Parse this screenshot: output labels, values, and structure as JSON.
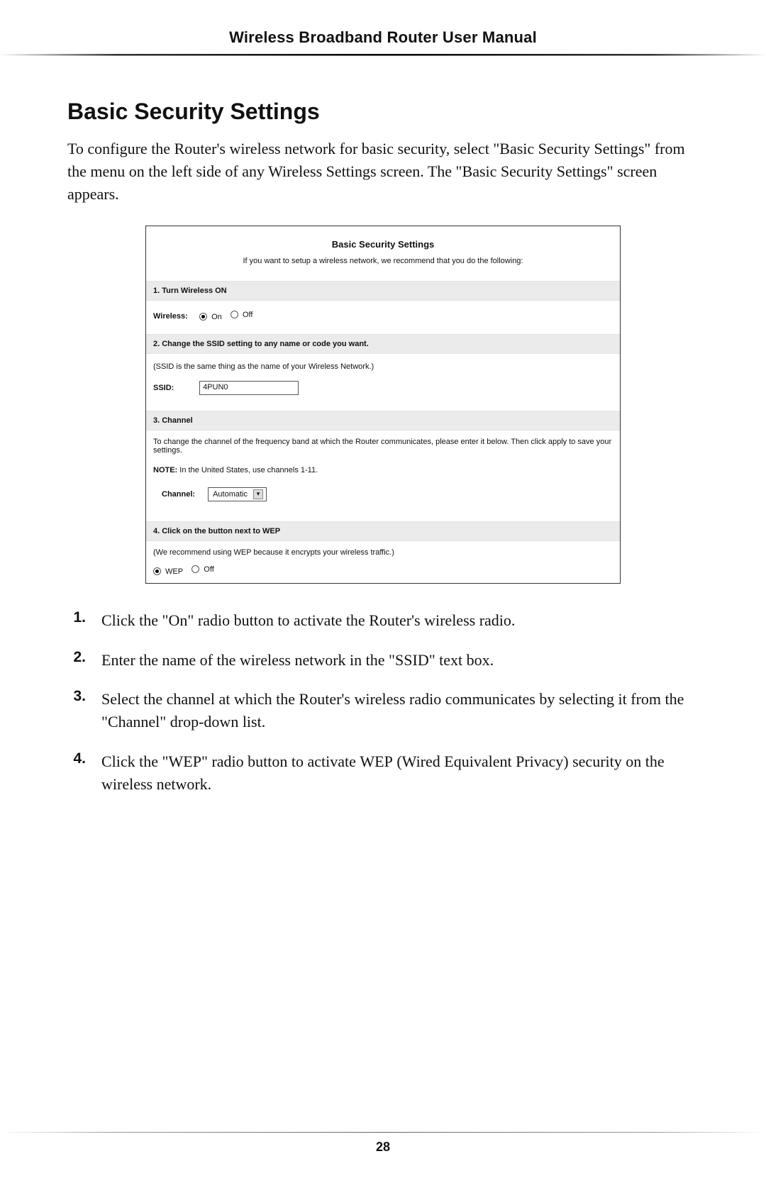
{
  "header": {
    "title": "Wireless Broadband Router User Manual"
  },
  "section": {
    "heading": "Basic Security Settings",
    "intro": "To configure the Router's wireless network for basic security, select \"Basic Security Settings\" from the menu on the left side of any Wireless Settings screen. The \"Basic Security Settings\" screen appears."
  },
  "screenshot": {
    "title": "Basic Security Settings",
    "subtitle": "If you want to setup a wireless network, we recommend that you do the following:",
    "band1": "1. Turn Wireless ON",
    "wireless_label": "Wireless:",
    "radio_on": "On",
    "radio_off": "Off",
    "band2": "2. Change the SSID setting to any name or code you want.",
    "ssid_note": "(SSID is the same thing as the name of your Wireless Network.)",
    "ssid_label": "SSID:",
    "ssid_value": "4PUN0",
    "band3": "3. Channel",
    "channel_desc": "To change the channel of the frequency band at which the Router communicates, please enter it below. Then click apply to save your settings.",
    "channel_note_prefix": "NOTE:",
    "channel_note_rest": " In the United States, use channels 1-11.",
    "channel_label": "Channel:",
    "channel_value": "Automatic",
    "band4": "4. Click on the button next to WEP",
    "wep_note": "(We recommend using WEP because it encrypts your wireless traffic.)",
    "wep_on": "WEP",
    "wep_off": "Off"
  },
  "instructions": [
    {
      "num": "1.",
      "pre": "Click the \"On\" radio button to activate the Router's wireless radio."
    },
    {
      "num": "2.",
      "pre": "Enter the name of the wireless network in the \"",
      "sc": "SSID",
      "post": "\" text box."
    },
    {
      "num": "3.",
      "pre": "Select the channel at which the Router's wireless radio communicates by selecting it from the \"Channel\" drop-down list."
    },
    {
      "num": "4.",
      "pre": "Click the \"",
      "sc": "WEP",
      "mid": "\" radio button to activate ",
      "sc2": "WEP",
      "post": " (Wired Equivalent Privacy) security on the wireless network."
    }
  ],
  "footer": {
    "page": "28"
  }
}
